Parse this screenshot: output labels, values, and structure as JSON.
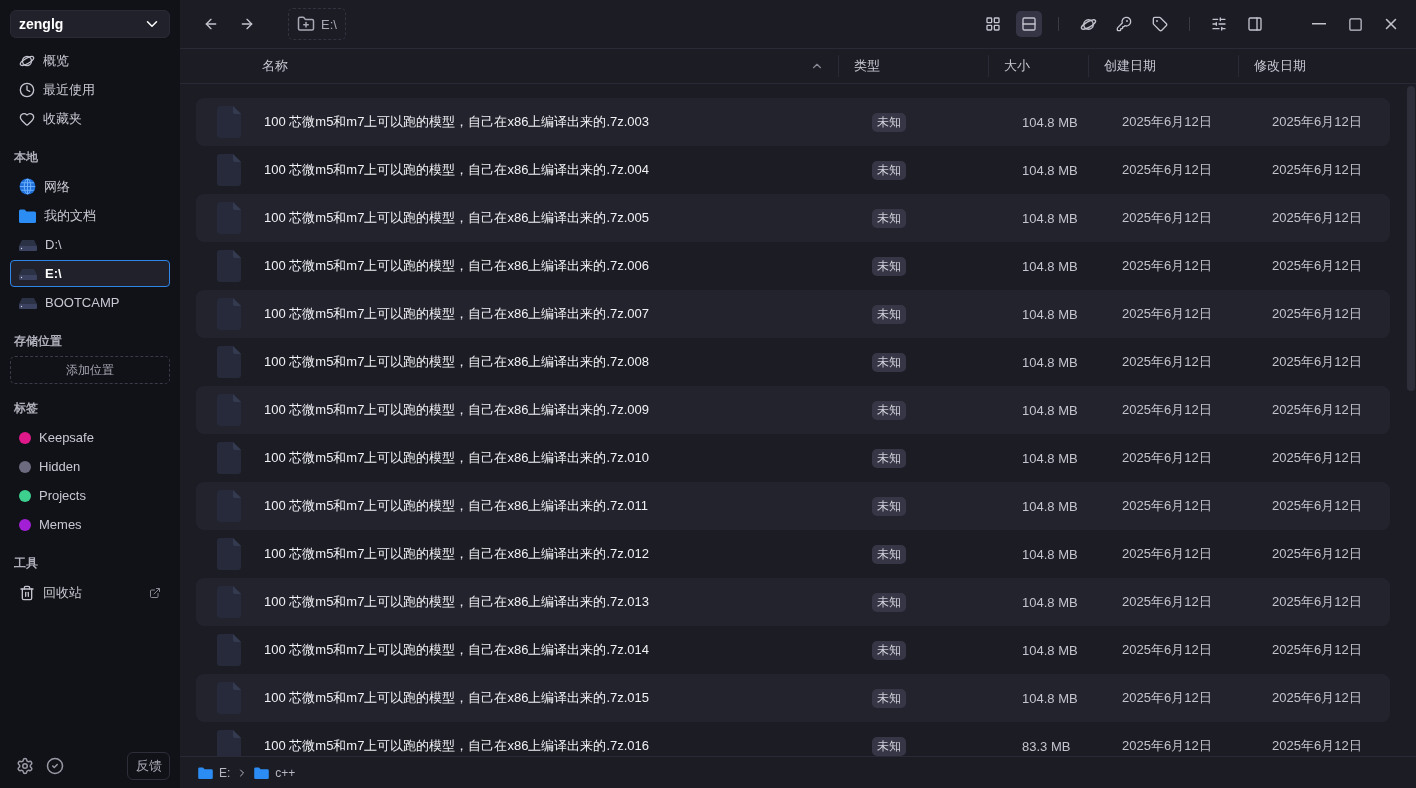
{
  "sidebar": {
    "account": "zenglg",
    "nav": [
      {
        "kind": "overview",
        "label": "概览"
      },
      {
        "kind": "recent",
        "label": "最近使用"
      },
      {
        "kind": "favorites",
        "label": "收藏夹"
      }
    ],
    "local": {
      "title": "本地",
      "items": [
        {
          "kind": "network",
          "label": "网络",
          "selected": false
        },
        {
          "kind": "documents",
          "label": "我的文档",
          "selected": false
        },
        {
          "kind": "drive",
          "label": "D:\\",
          "selected": false
        },
        {
          "kind": "drive",
          "label": "E:\\",
          "selected": true
        },
        {
          "kind": "drive",
          "label": "BOOTCAMP",
          "selected": false
        }
      ]
    },
    "storage": {
      "title": "存储位置",
      "add_button": "添加位置"
    },
    "tags": {
      "title": "标签",
      "items": [
        {
          "label": "Keepsafe",
          "color": "#e0198a"
        },
        {
          "label": "Hidden",
          "color": "#6b6a7e"
        },
        {
          "label": "Projects",
          "color": "#3ccf8e"
        },
        {
          "label": "Memes",
          "color": "#a21fd6"
        }
      ]
    },
    "tools": {
      "title": "工具",
      "items": [
        {
          "label": "回收站"
        }
      ]
    },
    "feedback_button": "反馈"
  },
  "toolbar": {
    "path": "E:\\",
    "views": [
      {
        "kind": "grid",
        "selected": false
      },
      {
        "kind": "list",
        "selected": true
      }
    ]
  },
  "table": {
    "columns": [
      {
        "label": "名称",
        "sorted": true
      },
      {
        "label": "类型",
        "sorted": false
      },
      {
        "label": "大小",
        "sorted": false
      },
      {
        "label": "创建日期",
        "sorted": false
      },
      {
        "label": "修改日期",
        "sorted": false
      }
    ],
    "rows": [
      {
        "name": "100 芯微m5和m7上可以跑的模型，自己在x86上编译出来的.7z.003",
        "type": "未知",
        "size": "104.8 MB",
        "created": "2025年6月12日",
        "modified": "2025年6月12日"
      },
      {
        "name": "100 芯微m5和m7上可以跑的模型，自己在x86上编译出来的.7z.004",
        "type": "未知",
        "size": "104.8 MB",
        "created": "2025年6月12日",
        "modified": "2025年6月12日"
      },
      {
        "name": "100 芯微m5和m7上可以跑的模型，自己在x86上编译出来的.7z.005",
        "type": "未知",
        "size": "104.8 MB",
        "created": "2025年6月12日",
        "modified": "2025年6月12日"
      },
      {
        "name": "100 芯微m5和m7上可以跑的模型，自己在x86上编译出来的.7z.006",
        "type": "未知",
        "size": "104.8 MB",
        "created": "2025年6月12日",
        "modified": "2025年6月12日"
      },
      {
        "name": "100 芯微m5和m7上可以跑的模型，自己在x86上编译出来的.7z.007",
        "type": "未知",
        "size": "104.8 MB",
        "created": "2025年6月12日",
        "modified": "2025年6月12日"
      },
      {
        "name": "100 芯微m5和m7上可以跑的模型，自己在x86上编译出来的.7z.008",
        "type": "未知",
        "size": "104.8 MB",
        "created": "2025年6月12日",
        "modified": "2025年6月12日"
      },
      {
        "name": "100 芯微m5和m7上可以跑的模型，自己在x86上编译出来的.7z.009",
        "type": "未知",
        "size": "104.8 MB",
        "created": "2025年6月12日",
        "modified": "2025年6月12日"
      },
      {
        "name": "100 芯微m5和m7上可以跑的模型，自己在x86上编译出来的.7z.010",
        "type": "未知",
        "size": "104.8 MB",
        "created": "2025年6月12日",
        "modified": "2025年6月12日"
      },
      {
        "name": "100 芯微m5和m7上可以跑的模型，自己在x86上编译出来的.7z.011",
        "type": "未知",
        "size": "104.8 MB",
        "created": "2025年6月12日",
        "modified": "2025年6月12日"
      },
      {
        "name": "100 芯微m5和m7上可以跑的模型，自己在x86上编译出来的.7z.012",
        "type": "未知",
        "size": "104.8 MB",
        "created": "2025年6月12日",
        "modified": "2025年6月12日"
      },
      {
        "name": "100 芯微m5和m7上可以跑的模型，自己在x86上编译出来的.7z.013",
        "type": "未知",
        "size": "104.8 MB",
        "created": "2025年6月12日",
        "modified": "2025年6月12日"
      },
      {
        "name": "100 芯微m5和m7上可以跑的模型，自己在x86上编译出来的.7z.014",
        "type": "未知",
        "size": "104.8 MB",
        "created": "2025年6月12日",
        "modified": "2025年6月12日"
      },
      {
        "name": "100 芯微m5和m7上可以跑的模型，自己在x86上编译出来的.7z.015",
        "type": "未知",
        "size": "104.8 MB",
        "created": "2025年6月12日",
        "modified": "2025年6月12日"
      },
      {
        "name": "100 芯微m5和m7上可以跑的模型，自己在x86上编译出来的.7z.016",
        "type": "未知",
        "size": "83.3 MB",
        "created": "2025年6月12日",
        "modified": "2025年6月12日"
      }
    ]
  },
  "status_bar": {
    "breadcrumb": [
      {
        "label": "E:"
      },
      {
        "label": "c++"
      }
    ]
  }
}
